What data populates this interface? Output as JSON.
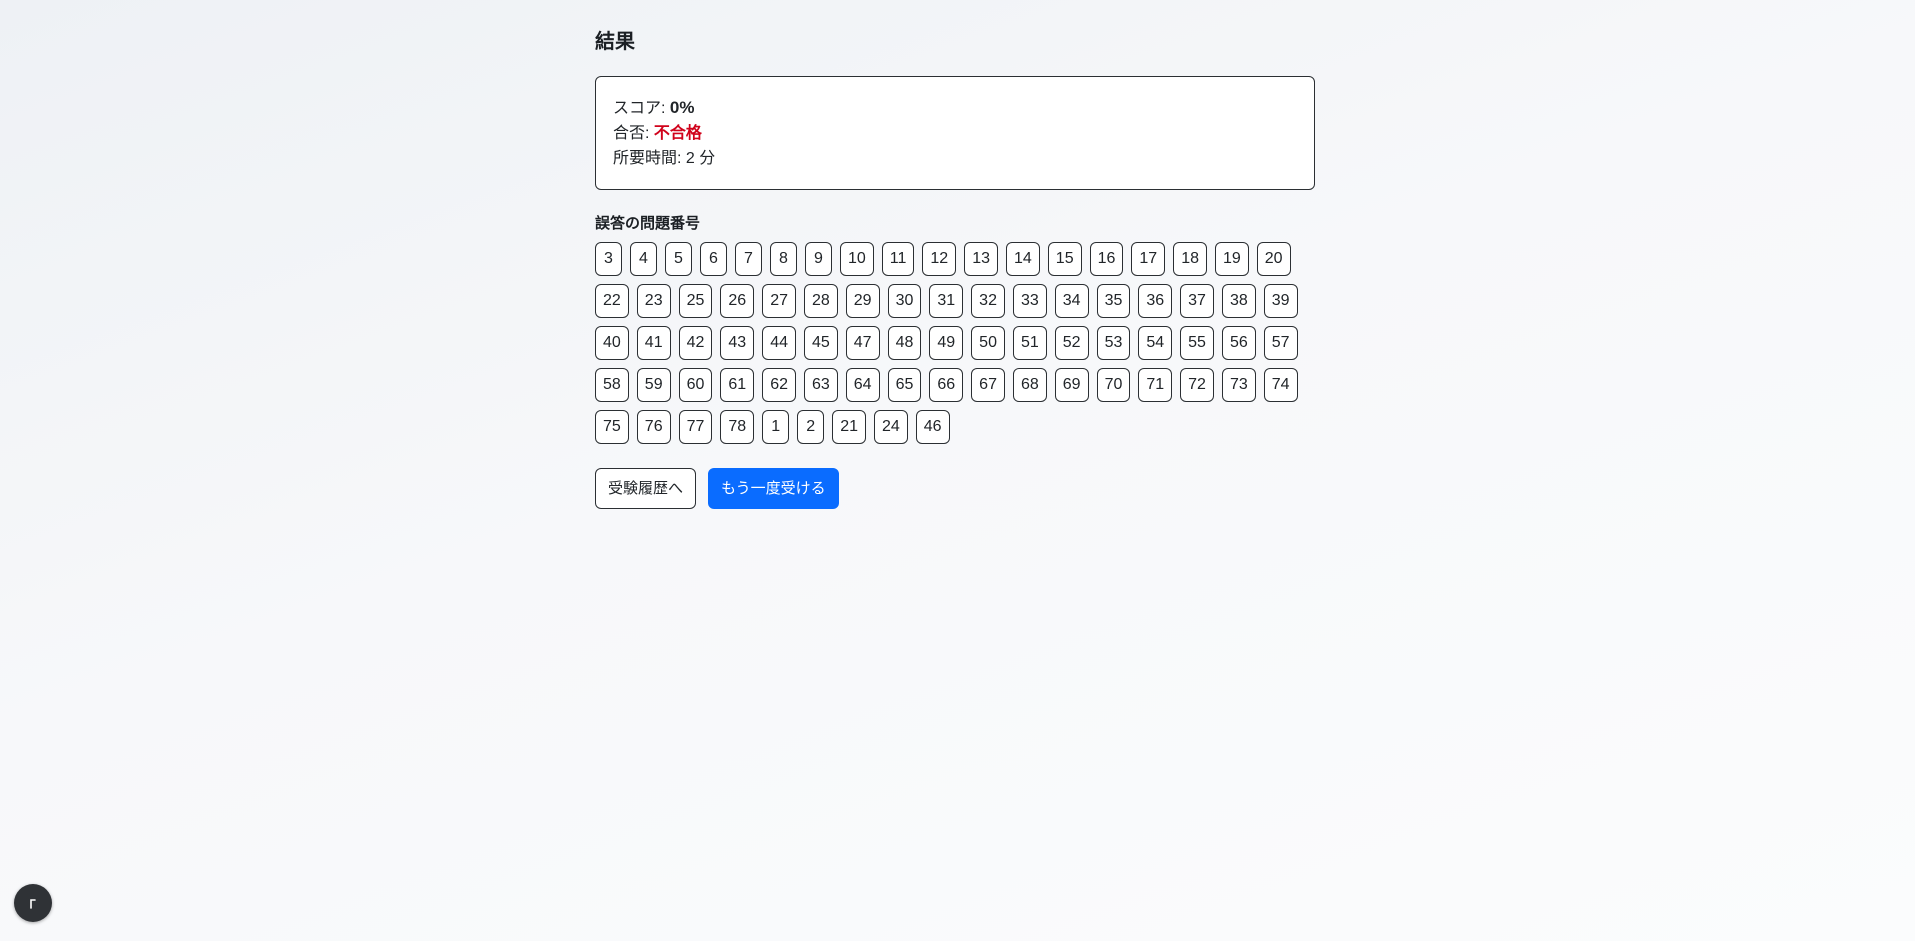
{
  "page": {
    "title": "結果"
  },
  "summary": {
    "score_label": "スコア: ",
    "score_value": "0%",
    "result_label": "合否: ",
    "result_value": "不合格",
    "time_label": "所要時間: ",
    "time_value": "2 分"
  },
  "incorrect": {
    "title": "誤答の問題番号",
    "numbers": [
      "3",
      "4",
      "5",
      "6",
      "7",
      "8",
      "9",
      "10",
      "11",
      "12",
      "13",
      "14",
      "15",
      "16",
      "17",
      "18",
      "19",
      "20",
      "22",
      "23",
      "25",
      "26",
      "27",
      "28",
      "29",
      "30",
      "31",
      "32",
      "33",
      "34",
      "35",
      "36",
      "37",
      "38",
      "39",
      "40",
      "41",
      "42",
      "43",
      "44",
      "45",
      "47",
      "48",
      "49",
      "50",
      "51",
      "52",
      "53",
      "54",
      "55",
      "56",
      "57",
      "58",
      "59",
      "60",
      "61",
      "62",
      "63",
      "64",
      "65",
      "66",
      "67",
      "68",
      "69",
      "70",
      "71",
      "72",
      "73",
      "74",
      "75",
      "76",
      "77",
      "78",
      "1",
      "2",
      "21",
      "24",
      "46"
    ]
  },
  "actions": {
    "history_label": "受験履歴へ",
    "retry_label": "もう一度受ける"
  },
  "colors": {
    "accent": "#0a6cff",
    "fail": "#d0021b",
    "border": "#2b2f33"
  },
  "icons": {
    "floating": "cursor-icon"
  }
}
